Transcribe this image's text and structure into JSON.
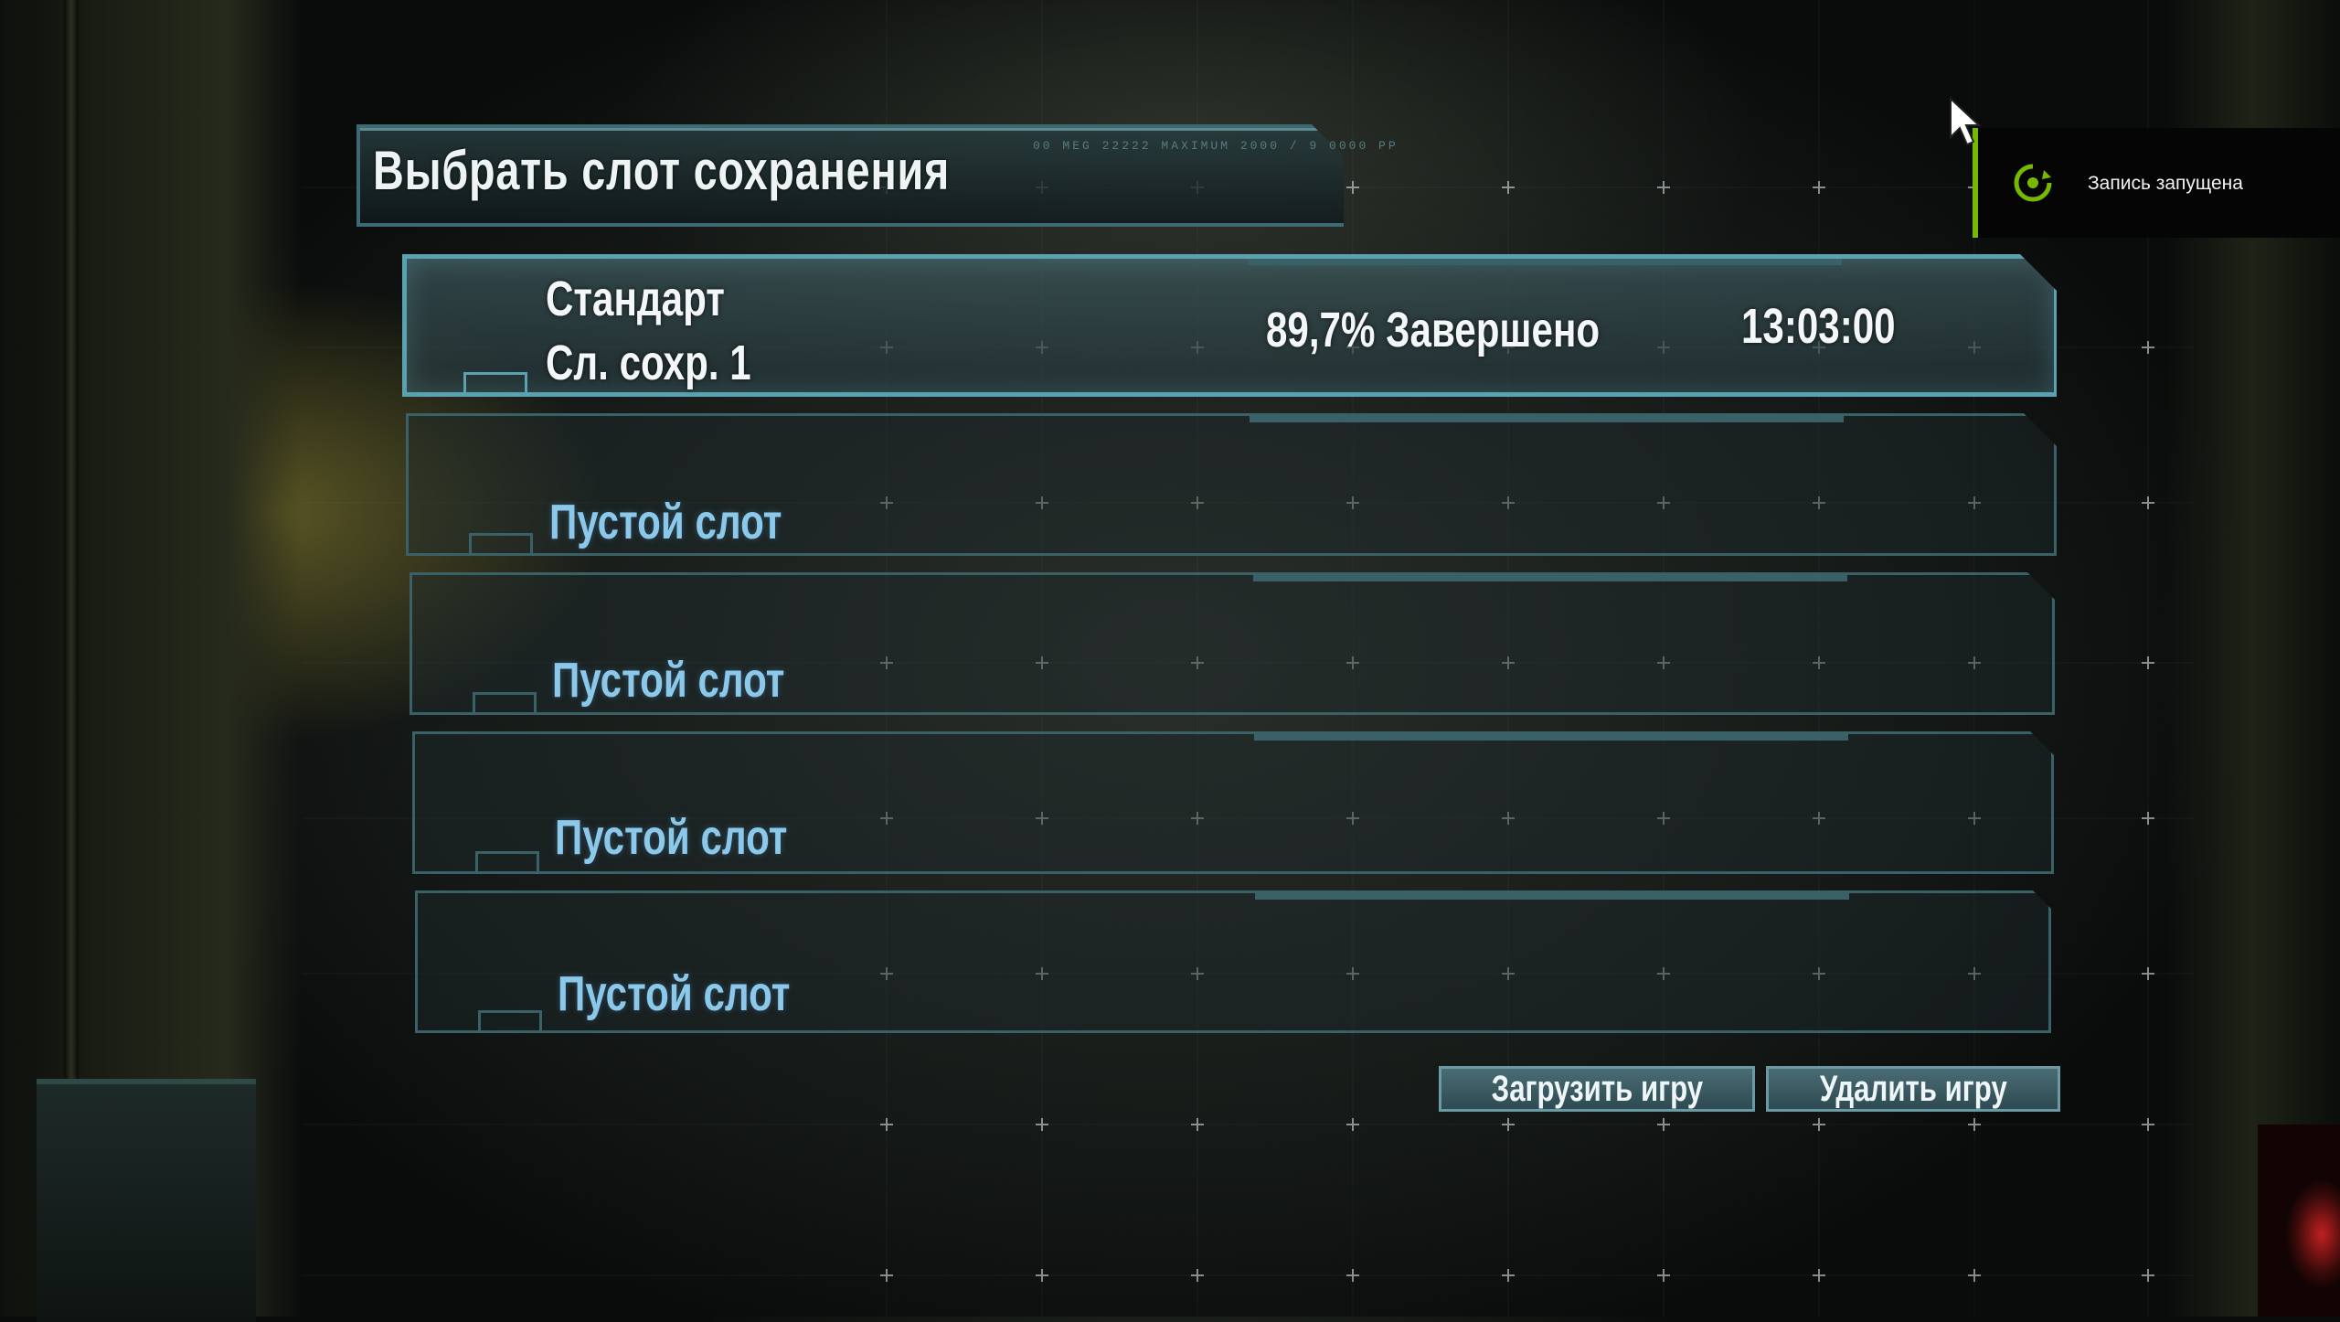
{
  "screen": {
    "title": "Выбрать слот сохранения",
    "title_panel_text": "00 MEG 22222 MAXIMUM 2000 / 9 0000 PP"
  },
  "save_slots": [
    {
      "line1": "Стандарт",
      "line2": "Сл. сохр. 1",
      "progress": "89,7% Завершено",
      "time": "13:03:00",
      "selected": true
    },
    {
      "label": "Пустой слот"
    },
    {
      "label": "Пустой слот"
    },
    {
      "label": "Пустой слот"
    },
    {
      "label": "Пустой слот"
    }
  ],
  "buttons": {
    "load": "Загрузить игру",
    "delete": "Удалить игру"
  },
  "notification": {
    "text": "Запись запущена",
    "accent_color": "#76b900"
  },
  "colors": {
    "slot_border": "#3a6068",
    "slot_selected_border": "#5aa2b0",
    "empty_label": "#8cc8ea"
  }
}
